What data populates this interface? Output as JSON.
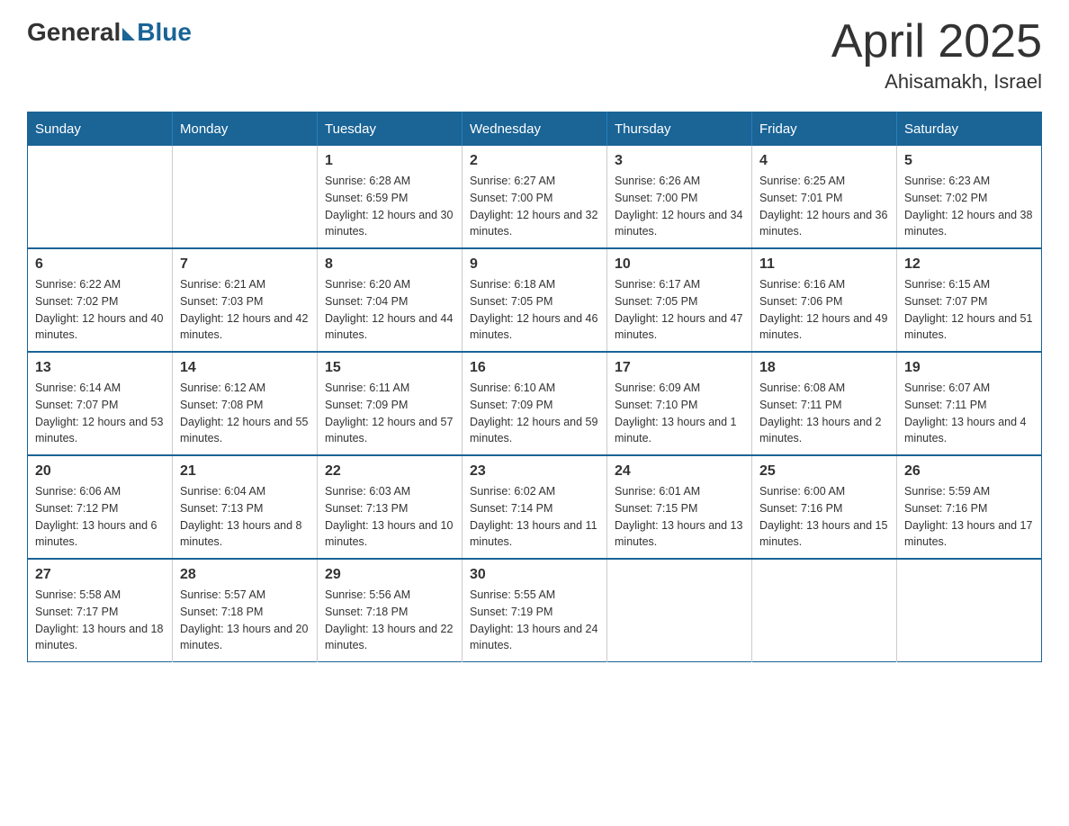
{
  "header": {
    "logo_general": "General",
    "logo_blue": "Blue",
    "month_title": "April 2025",
    "location": "Ahisamakh, Israel"
  },
  "days_of_week": [
    "Sunday",
    "Monday",
    "Tuesday",
    "Wednesday",
    "Thursday",
    "Friday",
    "Saturday"
  ],
  "weeks": [
    [
      {
        "day": "",
        "info": ""
      },
      {
        "day": "",
        "info": ""
      },
      {
        "day": "1",
        "sunrise": "6:28 AM",
        "sunset": "6:59 PM",
        "daylight": "12 hours and 30 minutes."
      },
      {
        "day": "2",
        "sunrise": "6:27 AM",
        "sunset": "7:00 PM",
        "daylight": "12 hours and 32 minutes."
      },
      {
        "day": "3",
        "sunrise": "6:26 AM",
        "sunset": "7:00 PM",
        "daylight": "12 hours and 34 minutes."
      },
      {
        "day": "4",
        "sunrise": "6:25 AM",
        "sunset": "7:01 PM",
        "daylight": "12 hours and 36 minutes."
      },
      {
        "day": "5",
        "sunrise": "6:23 AM",
        "sunset": "7:02 PM",
        "daylight": "12 hours and 38 minutes."
      }
    ],
    [
      {
        "day": "6",
        "sunrise": "6:22 AM",
        "sunset": "7:02 PM",
        "daylight": "12 hours and 40 minutes."
      },
      {
        "day": "7",
        "sunrise": "6:21 AM",
        "sunset": "7:03 PM",
        "daylight": "12 hours and 42 minutes."
      },
      {
        "day": "8",
        "sunrise": "6:20 AM",
        "sunset": "7:04 PM",
        "daylight": "12 hours and 44 minutes."
      },
      {
        "day": "9",
        "sunrise": "6:18 AM",
        "sunset": "7:05 PM",
        "daylight": "12 hours and 46 minutes."
      },
      {
        "day": "10",
        "sunrise": "6:17 AM",
        "sunset": "7:05 PM",
        "daylight": "12 hours and 47 minutes."
      },
      {
        "day": "11",
        "sunrise": "6:16 AM",
        "sunset": "7:06 PM",
        "daylight": "12 hours and 49 minutes."
      },
      {
        "day": "12",
        "sunrise": "6:15 AM",
        "sunset": "7:07 PM",
        "daylight": "12 hours and 51 minutes."
      }
    ],
    [
      {
        "day": "13",
        "sunrise": "6:14 AM",
        "sunset": "7:07 PM",
        "daylight": "12 hours and 53 minutes."
      },
      {
        "day": "14",
        "sunrise": "6:12 AM",
        "sunset": "7:08 PM",
        "daylight": "12 hours and 55 minutes."
      },
      {
        "day": "15",
        "sunrise": "6:11 AM",
        "sunset": "7:09 PM",
        "daylight": "12 hours and 57 minutes."
      },
      {
        "day": "16",
        "sunrise": "6:10 AM",
        "sunset": "7:09 PM",
        "daylight": "12 hours and 59 minutes."
      },
      {
        "day": "17",
        "sunrise": "6:09 AM",
        "sunset": "7:10 PM",
        "daylight": "13 hours and 1 minute."
      },
      {
        "day": "18",
        "sunrise": "6:08 AM",
        "sunset": "7:11 PM",
        "daylight": "13 hours and 2 minutes."
      },
      {
        "day": "19",
        "sunrise": "6:07 AM",
        "sunset": "7:11 PM",
        "daylight": "13 hours and 4 minutes."
      }
    ],
    [
      {
        "day": "20",
        "sunrise": "6:06 AM",
        "sunset": "7:12 PM",
        "daylight": "13 hours and 6 minutes."
      },
      {
        "day": "21",
        "sunrise": "6:04 AM",
        "sunset": "7:13 PM",
        "daylight": "13 hours and 8 minutes."
      },
      {
        "day": "22",
        "sunrise": "6:03 AM",
        "sunset": "7:13 PM",
        "daylight": "13 hours and 10 minutes."
      },
      {
        "day": "23",
        "sunrise": "6:02 AM",
        "sunset": "7:14 PM",
        "daylight": "13 hours and 11 minutes."
      },
      {
        "day": "24",
        "sunrise": "6:01 AM",
        "sunset": "7:15 PM",
        "daylight": "13 hours and 13 minutes."
      },
      {
        "day": "25",
        "sunrise": "6:00 AM",
        "sunset": "7:16 PM",
        "daylight": "13 hours and 15 minutes."
      },
      {
        "day": "26",
        "sunrise": "5:59 AM",
        "sunset": "7:16 PM",
        "daylight": "13 hours and 17 minutes."
      }
    ],
    [
      {
        "day": "27",
        "sunrise": "5:58 AM",
        "sunset": "7:17 PM",
        "daylight": "13 hours and 18 minutes."
      },
      {
        "day": "28",
        "sunrise": "5:57 AM",
        "sunset": "7:18 PM",
        "daylight": "13 hours and 20 minutes."
      },
      {
        "day": "29",
        "sunrise": "5:56 AM",
        "sunset": "7:18 PM",
        "daylight": "13 hours and 22 minutes."
      },
      {
        "day": "30",
        "sunrise": "5:55 AM",
        "sunset": "7:19 PM",
        "daylight": "13 hours and 24 minutes."
      },
      {
        "day": "",
        "info": ""
      },
      {
        "day": "",
        "info": ""
      },
      {
        "day": "",
        "info": ""
      }
    ]
  ]
}
